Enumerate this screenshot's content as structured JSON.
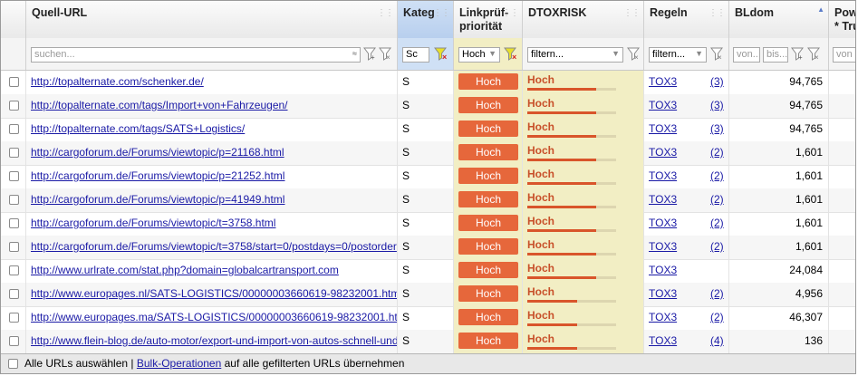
{
  "columns": {
    "url": "Quell-URL",
    "kateg": "Kateg",
    "linkprio_l1": "Linkprüf-",
    "linkprio_l2": "priorität",
    "dtoxrisk": "DTOXRISK",
    "regeln": "Regeln",
    "bldom": "BLdom",
    "pow_l1": "Pow",
    "pow_l2": "* Tru"
  },
  "filters": {
    "url_placeholder": "suchen...",
    "kateg_value": "Sc",
    "linkprio_value": "Hoch",
    "dtox_value": "filtern...",
    "regeln_value": "filtern...",
    "bldom_from": "von...",
    "bldom_to": "bis...",
    "pow_from": "von"
  },
  "rows": [
    {
      "url": "http://topalternate.com/schenker.de/",
      "kateg": "S",
      "prio": "Hoch",
      "dtox": "Hoch",
      "dtox_level": 0.78,
      "rule": "TOX3",
      "count": "(3)",
      "bldom": "94,765"
    },
    {
      "url": "http://topalternate.com/tags/Import+von+Fahrzeugen/",
      "kateg": "S",
      "prio": "Hoch",
      "dtox": "Hoch",
      "dtox_level": 0.78,
      "rule": "TOX3",
      "count": "(3)",
      "bldom": "94,765"
    },
    {
      "url": "http://topalternate.com/tags/SATS+Logistics/",
      "kateg": "S",
      "prio": "Hoch",
      "dtox": "Hoch",
      "dtox_level": 0.78,
      "rule": "TOX3",
      "count": "(3)",
      "bldom": "94,765"
    },
    {
      "url": "http://cargoforum.de/Forums/viewtopic/p=21168.html",
      "kateg": "S",
      "prio": "Hoch",
      "dtox": "Hoch",
      "dtox_level": 0.78,
      "rule": "TOX3",
      "count": "(2)",
      "bldom": "1,601"
    },
    {
      "url": "http://cargoforum.de/Forums/viewtopic/p=21252.html",
      "kateg": "S",
      "prio": "Hoch",
      "dtox": "Hoch",
      "dtox_level": 0.78,
      "rule": "TOX3",
      "count": "(2)",
      "bldom": "1,601"
    },
    {
      "url": "http://cargoforum.de/Forums/viewtopic/p=41949.html",
      "kateg": "S",
      "prio": "Hoch",
      "dtox": "Hoch",
      "dtox_level": 0.78,
      "rule": "TOX3",
      "count": "(2)",
      "bldom": "1,601"
    },
    {
      "url": "http://cargoforum.de/Forums/viewtopic/t=3758.html",
      "kateg": "S",
      "prio": "Hoch",
      "dtox": "Hoch",
      "dtox_level": 0.78,
      "rule": "TOX3",
      "count": "(2)",
      "bldom": "1,601"
    },
    {
      "url": "http://cargoforum.de/Forums/viewtopic/t=3758/start=0/postdays=0/postorder",
      "kateg": "S",
      "prio": "Hoch",
      "dtox": "Hoch",
      "dtox_level": 0.78,
      "rule": "TOX3",
      "count": "(2)",
      "bldom": "1,601"
    },
    {
      "url": "http://www.urlrate.com/stat.php?domain=globalcartransport.com",
      "kateg": "S",
      "prio": "Hoch",
      "dtox": "Hoch",
      "dtox_level": 0.78,
      "rule": "TOX3",
      "count": "",
      "bldom": "24,084"
    },
    {
      "url": "http://www.europages.nl/SATS-LOGISTICS/00000003660619-98232001.htm",
      "kateg": "S",
      "prio": "Hoch",
      "dtox": "Hoch",
      "dtox_level": 0.56,
      "rule": "TOX3",
      "count": "(2)",
      "bldom": "4,956"
    },
    {
      "url": "http://www.europages.ma/SATS-LOGISTICS/00000003660619-98232001.ht",
      "kateg": "S",
      "prio": "Hoch",
      "dtox": "Hoch",
      "dtox_level": 0.56,
      "rule": "TOX3",
      "count": "(2)",
      "bldom": "46,307"
    },
    {
      "url": "http://www.flein-blog.de/auto-motor/export-und-import-von-autos-schnell-und",
      "kateg": "S",
      "prio": "Hoch",
      "dtox": "Hoch",
      "dtox_level": 0.56,
      "rule": "TOX3",
      "count": "(4)",
      "bldom": "136"
    }
  ],
  "footer": {
    "select_all": "Alle URLs auswählen",
    "separator": "|",
    "bulk_link": "Bulk-Operationen",
    "suffix": "auf alle gefilterten URLs übernehmen"
  },
  "colors": {
    "prio_button": "#e6673b",
    "dtox_bg": "#f2eec4",
    "dtox_text": "#c8502a",
    "link": "#1a1aa6",
    "selected_header": "#cfe0f5"
  }
}
